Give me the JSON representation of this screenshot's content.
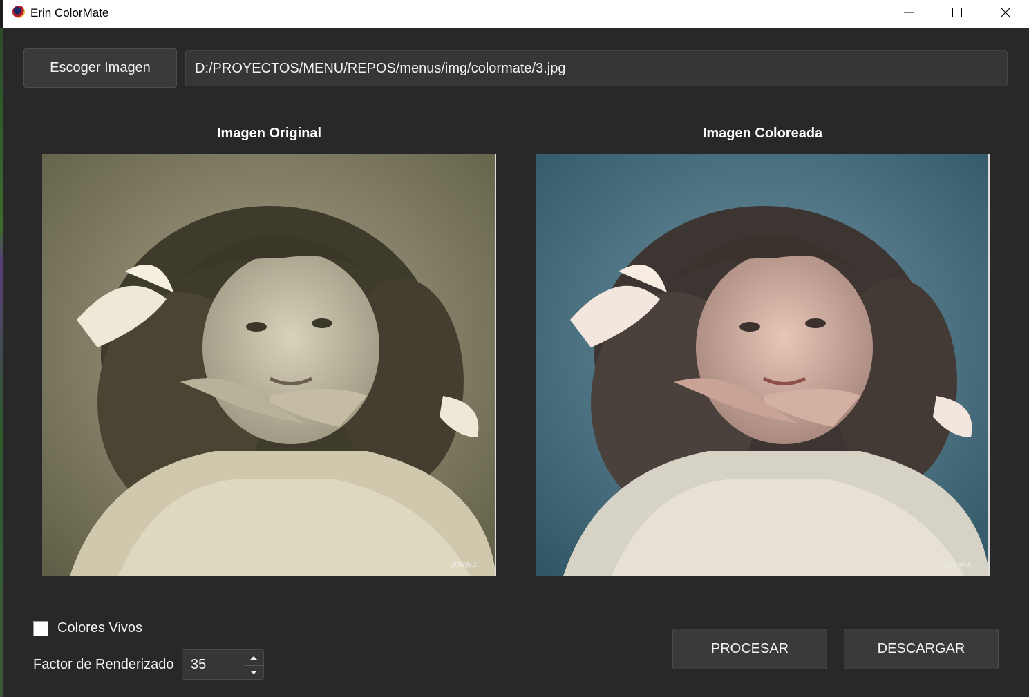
{
  "window": {
    "title": "Erin ColorMate",
    "icons": {
      "app": "colormate-app-icon",
      "minimize": "minimize-icon",
      "maximize": "maximize-icon",
      "close": "close-icon"
    }
  },
  "toolbar": {
    "pick_button_label": "Escoger Imagen",
    "path_value": "D:/PROYECTOS/MENU/REPOS/menus/img/colormate/3.jpg"
  },
  "panels": {
    "original_title": "Imagen Original",
    "colored_title": "Imagen Coloreada",
    "photo_corner_mark": "3069/3."
  },
  "options": {
    "vivid_colors_label": "Colores Vivos",
    "vivid_colors_checked": false,
    "render_factor_label": "Factor de Renderizado",
    "render_factor_value": "35"
  },
  "actions": {
    "process_label": "PROCESAR",
    "download_label": "DESCARGAR"
  },
  "colors": {
    "background": "#282828",
    "button": "#3a3a3a",
    "field": "#363636",
    "text": "#f2f2f2"
  }
}
